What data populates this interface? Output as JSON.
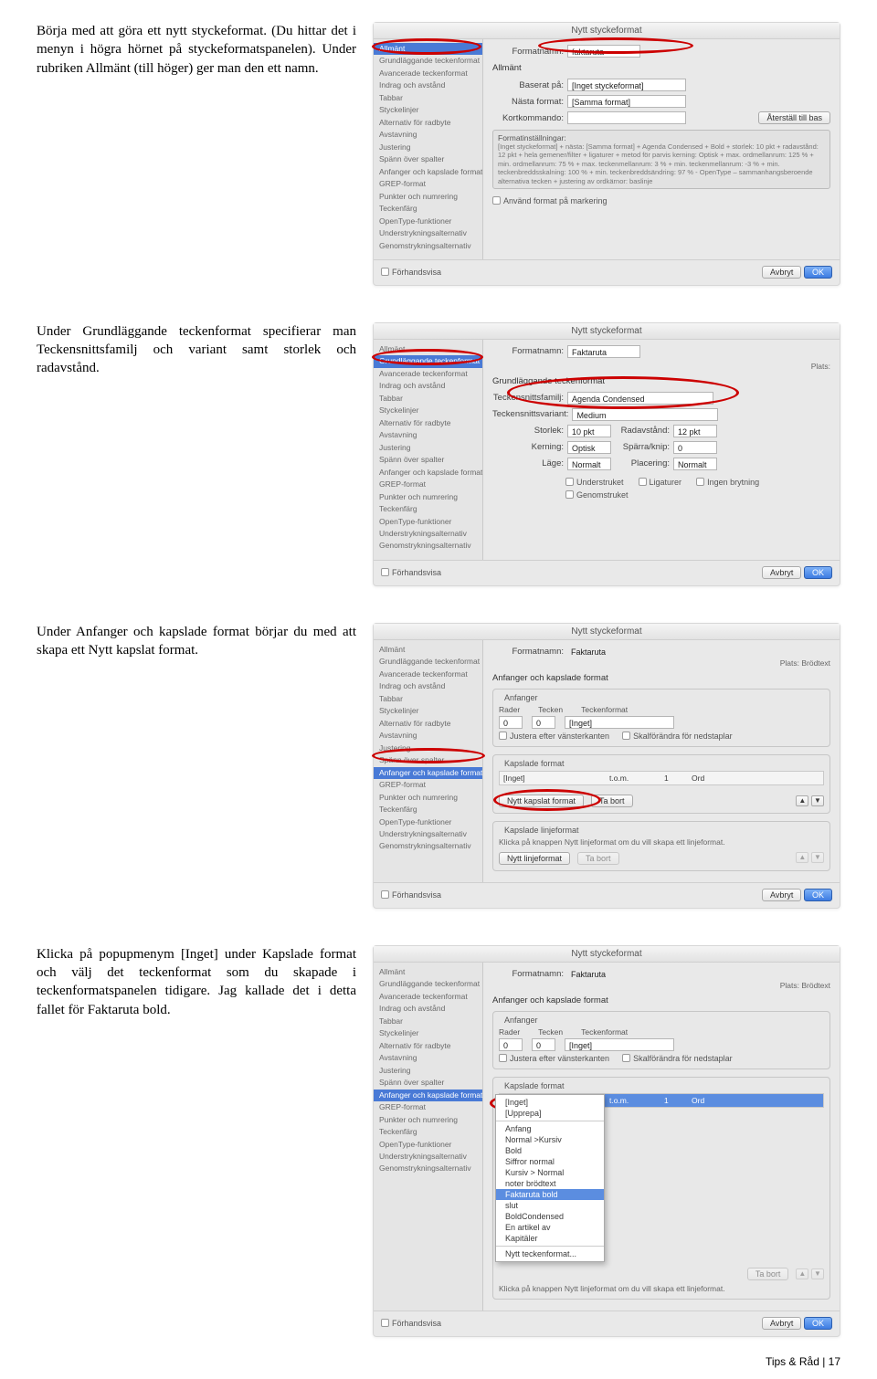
{
  "para1": "Börja med att göra ett nytt styckeformat. (Du hittar det i menyn i högra hörnet på styckeformatspanelen). Under rubriken Allmänt (till höger) ger man den ett namn.",
  "para2": "Under Grundläggande teckenformat specifierar man Teckensnittsfamilj och variant samt storlek och radavstånd.",
  "para3": "Under Anfanger och kapslade format börjar du med att skapa ett Nytt kapslat format.",
  "para4": "Klicka på popupmenym [Inget] under Kapslade format och välj det teckenformat som du skapade i teckenformatspanelen tidigare. Jag kallade det i detta fallet för Faktaruta bold.",
  "dlg": {
    "title": "Nytt styckeformat",
    "sidebar_full": [
      "Allmänt",
      "Grundläggande teckenformat",
      "Avancerade teckenformat",
      "Indrag och avstånd",
      "Tabbar",
      "Styckelinjer",
      "Alternativ för radbyte",
      "Avstavning",
      "Justering",
      "Spänn över spalter",
      "Anfanger och kapslade format",
      "GREP-format",
      "Punkter och numrering",
      "Teckenfärg",
      "OpenType-funktioner",
      "Understrykningsalternativ",
      "Genomstrykningsalternativ"
    ],
    "formatname_lbl": "Formatnamn:",
    "formatname1": "faktaruta",
    "formatname2": "Faktaruta",
    "plats_lbl": "Plats:",
    "plats_val": "Brödtext",
    "allmant_head": "Allmänt",
    "baserat_lbl": "Baserat på:",
    "baserat_val": "[Inget styckeformat]",
    "nasta_lbl": "Nästa format:",
    "nasta_val": "[Samma format]",
    "kort_lbl": "Kortkommando:",
    "aterst": "Återställ till bas",
    "settings_head": "Formatinställningar:",
    "settings_body": "[Inget styckeformat] + nästa: [Samma format] + Agenda Condensed + Bold + storlek: 10 pkt + radavstånd: 12 pkt + hela gemener/filter + ligaturer + metod för parvis kerning: Optisk + max. ordmellanrum: 125 % + min. ordmellanrum: 75 % + max. teckenmellanrum: 3 % + min. teckenmellanrum: -3 % + min. teckenbreddsskalning: 100 % + min. teckenbreddsändring: 97 % - OpenType – sammanhangsberoende alternativa tecken + justering av ordkärnor: baslinje",
    "anvand": "Använd format på markering",
    "forhandsvisa": "Förhandsvisa",
    "avbryt": "Avbryt",
    "ok": "OK",
    "gtf_head": "Grundläggande teckenformat",
    "tfam_lbl": "Teckensnittsfamilj:",
    "tfam_val": "Agenda Condensed",
    "tvar_lbl": "Teckensnittsvariant:",
    "tvar_val": "Medium",
    "storlek_lbl": "Storlek:",
    "storlek_val": "10 pkt",
    "radavst_lbl": "Radavstånd:",
    "radavst_val": "12 pkt",
    "kerning_lbl": "Kerning:",
    "kerning_val": "Optisk",
    "sparrn_lbl": "Spärra/knip:",
    "sparrn_val": "0",
    "lage_lbl": "Läge:",
    "lage_val": "Normalt",
    "placering_lbl": "Placering:",
    "placering_val": "Normalt",
    "chk_under": "Understruket",
    "chk_lig": "Ligaturer",
    "chk_nobreak": "Ingen brytning",
    "chk_genom": "Genomstruket",
    "anf_head": "Anfanger och kapslade format",
    "anf_group": "Anfanger",
    "anf_rader": "Rader",
    "anf_tecken": "Tecken",
    "anf_tformat": "Teckenformat",
    "anf_val0": "0",
    "anf_inget": "[Inget]",
    "anf_justera": "Justera efter vänsterkanten",
    "anf_skal": "Skalförändra för nedstaplar",
    "kap_group": "Kapslade format",
    "kap_inget": "[Inget]",
    "kap_tom": "t.o.m.",
    "kap_1": "1",
    "kap_ord": "Ord",
    "nytt_kapslat": "Nytt kapslat format",
    "tabort": "Ta bort",
    "linj_group": "Kapslade linjeformat",
    "linj_hint": "Klicka på knappen Nytt linjeformat om du vill skapa ett linjeformat.",
    "nytt_linje": "Nytt linjeformat",
    "popup_items": [
      "[Inget]",
      "[Upprepa]",
      "Anfang",
      "Normal >Kursiv",
      "Bold",
      "Siffror normal",
      "Kursiv > Normal",
      "noter brödtext",
      "Faktaruta bold",
      "slut",
      "BoldCondensed",
      "En artikel av",
      "Kapitäler"
    ],
    "popup_bottom": "Nytt teckenformat...",
    "kap_sel": "Faktaruta bold"
  },
  "footer": "Tips & Råd | 17"
}
